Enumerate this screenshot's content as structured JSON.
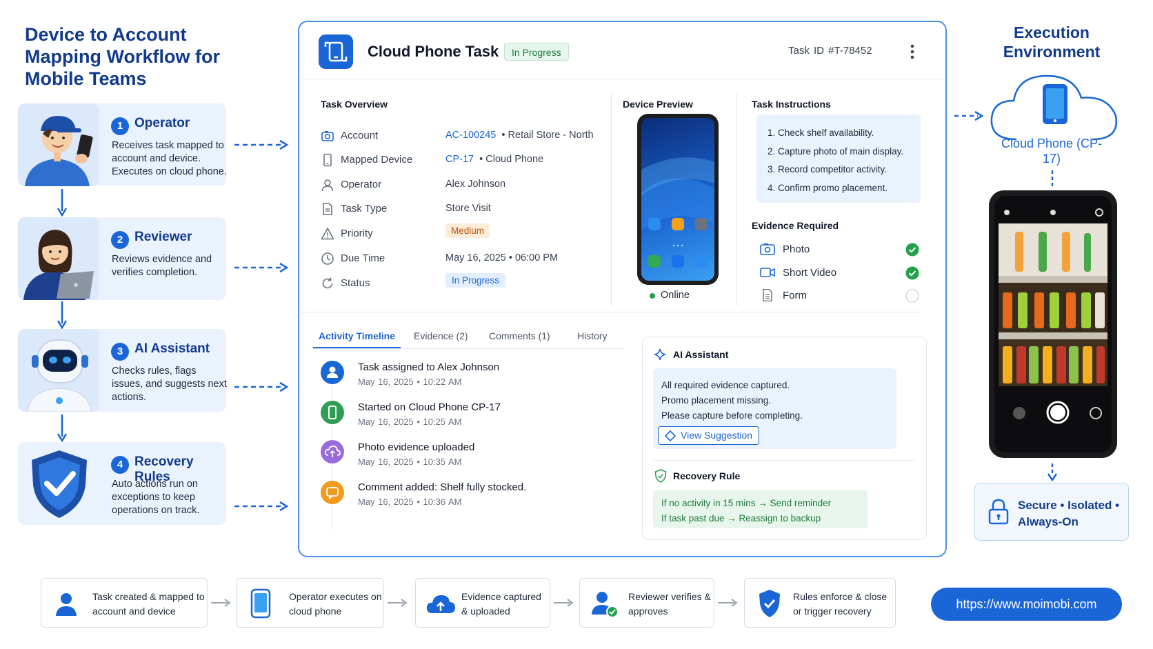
{
  "main_title": "Device to Account Mapping Workflow for Mobile Teams",
  "roles": [
    {
      "num": "1",
      "name": "Operator",
      "desc": "Receives task mapped to account and device. Executes on cloud phone."
    },
    {
      "num": "2",
      "name": "Reviewer",
      "desc": "Reviews evidence and verifies completion."
    },
    {
      "num": "3",
      "name": "AI Assistant",
      "desc": "Checks rules, flags issues, and suggests next actions."
    },
    {
      "num": "4",
      "name": "Recovery Rules",
      "desc": "Auto actions run on exceptions to keep operations on track."
    }
  ],
  "task": {
    "title": "Cloud Phone Task",
    "status_badge": "In Progress",
    "task_id": "Task ID  #T-78452"
  },
  "overview": {
    "title": "Task Overview",
    "rows": [
      {
        "label": "Account",
        "value_link": "AC-100245",
        "value_extra": "•  Retail Store - North"
      },
      {
        "label": "Mapped Device",
        "value_link": "CP-17",
        "value_extra": "•  Cloud Phone"
      },
      {
        "label": "Operator",
        "value": "Alex Johnson"
      },
      {
        "label": "Task Type",
        "value": "Store Visit"
      },
      {
        "label": "Priority",
        "value": "Medium"
      },
      {
        "label": "Due Time",
        "value": "May 16, 2025  •  06:00 PM"
      },
      {
        "label": "Status",
        "value": "In Progress"
      }
    ]
  },
  "device_preview": {
    "title": "Device Preview",
    "status": "Online"
  },
  "instructions": {
    "title": "Task Instructions",
    "items": [
      "1.  Check shelf availability.",
      "2.  Capture photo of main display.",
      "3.  Record competitor activity.",
      "4.  Confirm promo placement."
    ]
  },
  "evidence": {
    "title": "Evidence Required",
    "items": [
      {
        "label": "Photo",
        "done": true
      },
      {
        "label": "Short Video",
        "done": true
      },
      {
        "label": "Form",
        "done": false
      }
    ]
  },
  "tabs": [
    "Activity Timeline",
    "Evidence (2)",
    "Comments (1)",
    "History"
  ],
  "timeline": [
    {
      "title": "Task assigned to Alex Johnson",
      "time": "May 16, 2025  •  10:22 AM"
    },
    {
      "title": "Started on Cloud Phone CP-17",
      "time": "May 16, 2025  •  10:25 AM"
    },
    {
      "title": "Photo evidence uploaded",
      "time": "May 16, 2025  •  10:35 AM"
    },
    {
      "title": "Comment added: Shelf fully stocked.",
      "time": "May 16, 2025  •  10:36 AM"
    }
  ],
  "ai_assistant": {
    "title": "AI Assistant",
    "lines": [
      "All required evidence captured.",
      "Promo placement missing.",
      "Please capture before completing."
    ],
    "button": "View Suggestion"
  },
  "recovery_rule": {
    "title": "Recovery Rule",
    "lines": [
      "If no activity in 15 mins → Send reminder",
      "If task past due → Reassign to backup"
    ]
  },
  "execution": {
    "title": "Execution Environment",
    "cloud_label": "Cloud Phone (CP-17)",
    "secure": "Secure  •  Isolated  •  Always-On"
  },
  "steps": [
    "Task created & mapped to account and device",
    "Operator executes on cloud phone",
    "Evidence captured & uploaded",
    "Reviewer verifies & approves",
    "Rules enforce & close or trigger recovery"
  ],
  "url": "https://www.moimobi.com",
  "colors": {
    "primary": "#1a66d6",
    "navy": "#123a8c",
    "green": "#1e7a3d",
    "light_blue": "#eaf2fd"
  }
}
